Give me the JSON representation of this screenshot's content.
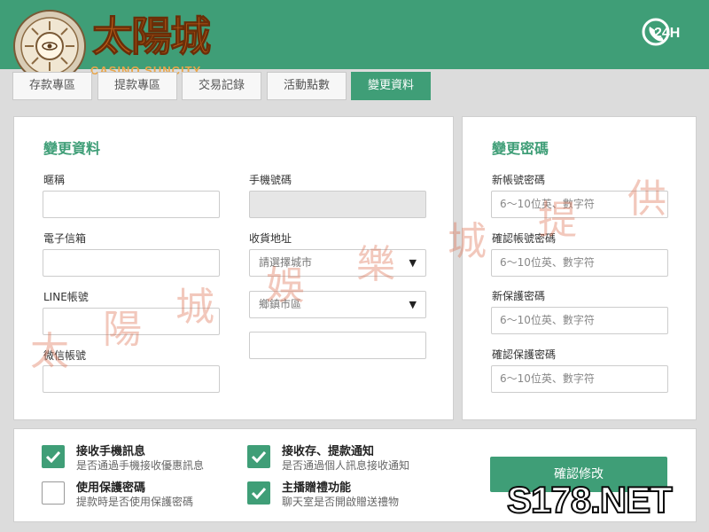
{
  "brand": {
    "name": "太陽城",
    "sub": "CASINO SUNCITY",
    "support_label": "24H"
  },
  "tabs": [
    "存款專區",
    "提款專區",
    "交易記錄",
    "活動點數",
    "變更資料"
  ],
  "profile": {
    "title": "變更資料",
    "fields": {
      "nickname": "暱稱",
      "phone": "手機號碼",
      "email": "電子信箱",
      "address": "收貨地址",
      "line": "LINE帳號",
      "wechat": "微信帳號"
    },
    "city_placeholder": "請選擇城市",
    "district_placeholder": "鄉鎮市區"
  },
  "password": {
    "title": "變更密碼",
    "fields": {
      "new_account": "新帳號密碼",
      "confirm_account": "確認帳號密碼",
      "new_protect": "新保護密碼",
      "confirm_protect": "確認保護密碼"
    },
    "placeholder": "6～10位英、數字符"
  },
  "options": [
    {
      "title": "接收手機訊息",
      "desc": "是否通過手機接收優惠訊息",
      "checked": true
    },
    {
      "title": "接收存、提款通知",
      "desc": "是否通過個人訊息接收通知",
      "checked": true
    },
    {
      "title": "使用保護密碼",
      "desc": "提款時是否使用保護密碼",
      "checked": false
    },
    {
      "title": "主播贈禮功能",
      "desc": "聊天室是否開啟贈送禮物",
      "checked": true
    }
  ],
  "confirm_label": "確認修改",
  "watermark": {
    "chars": [
      "太",
      "陽",
      "城",
      "娛",
      "樂",
      "城",
      "提",
      "供"
    ],
    "color": "#de6e50"
  },
  "site_mark": "S178.NET",
  "colors": {
    "accent": "#3f9e77",
    "brand": "#b85a18"
  }
}
